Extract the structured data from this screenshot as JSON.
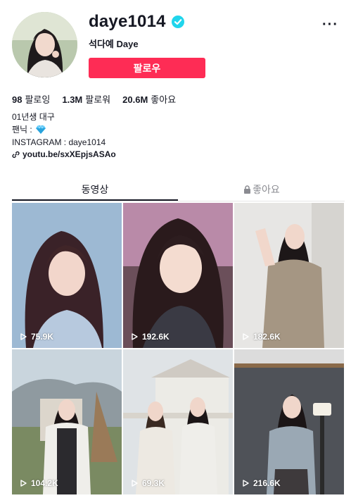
{
  "profile": {
    "username": "daye1014",
    "display_name": "석다예 Daye",
    "follow_label": "팔로우",
    "more_label": "···"
  },
  "stats": [
    {
      "value": "98",
      "label": "팔로잉"
    },
    {
      "value": "1.3M",
      "label": "팔로워"
    },
    {
      "value": "20.6M",
      "label": "좋아요"
    }
  ],
  "bio": {
    "line1": "01년생 대구",
    "line2": "팬닉 :",
    "line3": "INSTAGRAM : daye1014"
  },
  "link": "youtu.be/sxXEpjsASAo",
  "tabs": {
    "videos": "동영상",
    "liked": "좋아요"
  },
  "videos": [
    {
      "views": "75.9K"
    },
    {
      "views": "192.6K"
    },
    {
      "views": "182.6K"
    },
    {
      "views": "104.2K"
    },
    {
      "views": "69.3K"
    },
    {
      "views": "216.6K"
    }
  ],
  "colors": {
    "accent": "#fe2c55",
    "verified": "#20d5ec",
    "text": "#161823",
    "muted": "#8a8b91"
  }
}
